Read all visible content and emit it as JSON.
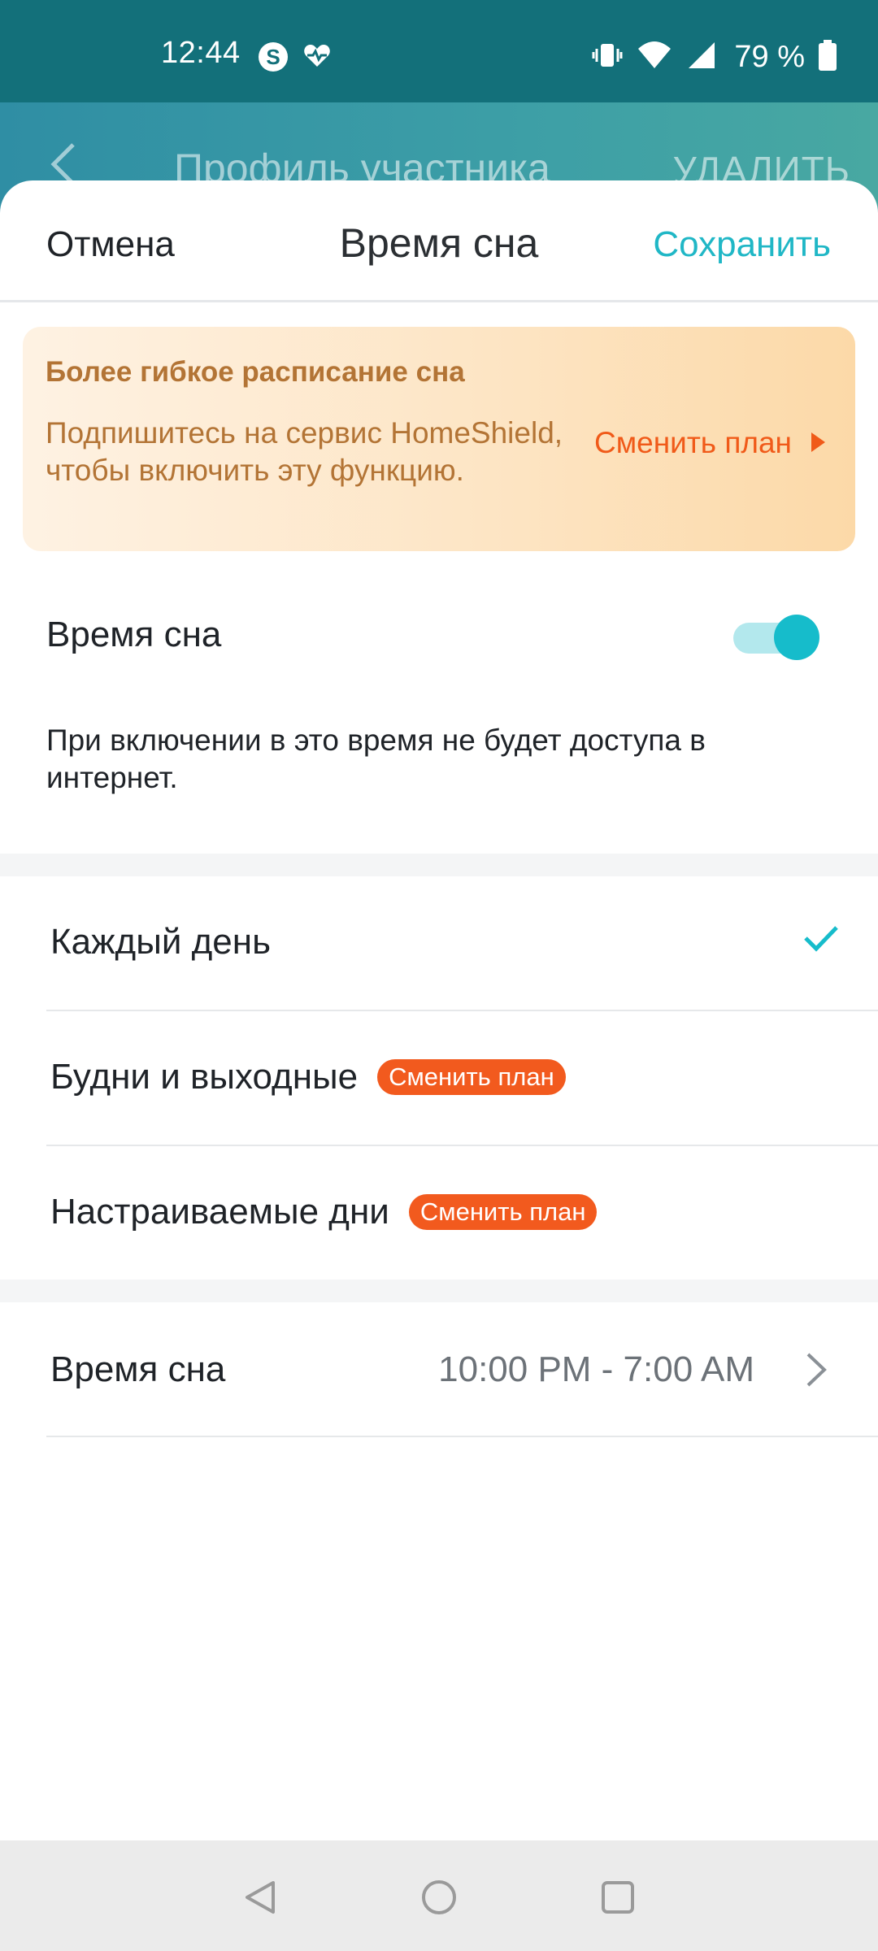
{
  "status_bar": {
    "time": "12:44",
    "battery": "79 %",
    "left_icons": [
      "skype-icon",
      "heart-pulse-icon"
    ],
    "right_icons": [
      "vibrate-icon",
      "wifi-icon",
      "cell-signal-icon",
      "battery-icon"
    ]
  },
  "background_header": {
    "title": "Профиль участника",
    "action": "УДАЛИТЬ"
  },
  "sheet": {
    "cancel_label": "Отмена",
    "title": "Время сна",
    "save_label": "Сохранить"
  },
  "promo": {
    "title": "Более гибкое расписание сна",
    "text": "Подпишитесь на сервис HomeShield, чтобы включить эту функцию.",
    "link": "Сменить план"
  },
  "sleep_toggle": {
    "label": "Время сна",
    "enabled": true,
    "description": "При включении в это время не будет доступа в интернет."
  },
  "schedule_options": [
    {
      "label": "Каждый день",
      "selected": true,
      "badge": ""
    },
    {
      "label": "Будни и выходные",
      "selected": false,
      "badge": "Сменить план"
    },
    {
      "label": "Настраиваемые дни",
      "selected": false,
      "badge": "Сменить план"
    }
  ],
  "sleep_time": {
    "label": "Время сна",
    "value": "10:00 PM - 7:00 AM"
  },
  "colors": {
    "accent": "#16bccb",
    "save_text": "#20b7c6",
    "promo_text": "#b37435",
    "badge": "#f25a1e",
    "status_bar": "#13707a"
  }
}
